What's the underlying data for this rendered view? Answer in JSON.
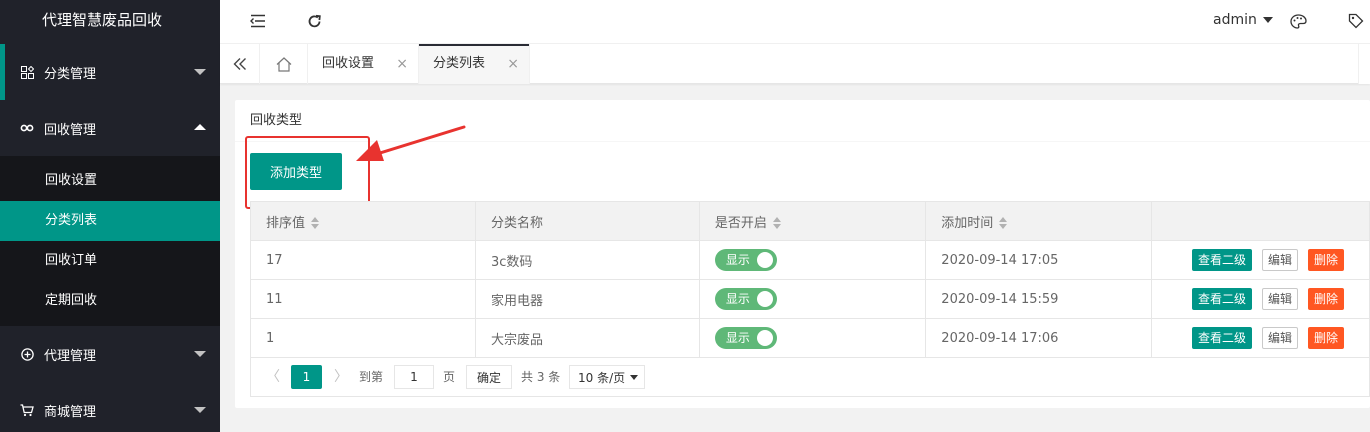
{
  "app": {
    "title": "代理智慧废品回收"
  },
  "sidebar": {
    "items": [
      {
        "label": "分类管理",
        "icon": "grid-icon"
      },
      {
        "label": "回收管理",
        "icon": "link-icon",
        "children": [
          {
            "label": "回收设置"
          },
          {
            "label": "分类列表",
            "selected": true
          },
          {
            "label": "回收订单"
          },
          {
            "label": "定期回收"
          }
        ]
      },
      {
        "label": "代理管理",
        "icon": "plus-circle-icon"
      },
      {
        "label": "商城管理",
        "icon": "cart-icon"
      }
    ]
  },
  "header": {
    "user": "admin"
  },
  "tabs": [
    {
      "label": "回收设置",
      "close": "×"
    },
    {
      "label": "分类列表",
      "close": "×",
      "active": true
    }
  ],
  "card": {
    "title": "回收类型",
    "add_button": "添加类型"
  },
  "table": {
    "columns": [
      "排序值",
      "分类名称",
      "是否开启",
      "添加时间",
      ""
    ],
    "rows": [
      {
        "sort": "17",
        "name": "3c数码",
        "status": "显示",
        "time": "2020-09-14 17:05"
      },
      {
        "sort": "11",
        "name": "家用电器",
        "status": "显示",
        "time": "2020-09-14 15:59"
      },
      {
        "sort": "1",
        "name": "大宗废品",
        "status": "显示",
        "time": "2020-09-14 17:06"
      }
    ],
    "actions": {
      "view": "查看二级",
      "edit": "编辑",
      "delete": "删除"
    }
  },
  "pager": {
    "prev": "〈",
    "next": "〉",
    "current": "1",
    "goto_label": "到第",
    "page_input": "1",
    "page_unit": "页",
    "confirm": "确定",
    "total": "共 3 条",
    "page_size": "10 条/页"
  },
  "colors": {
    "primary": "#009688",
    "sidebar": "#20222a",
    "danger": "#ff5722",
    "switch_on": "#5fb878",
    "annotation": "#e8332f"
  }
}
